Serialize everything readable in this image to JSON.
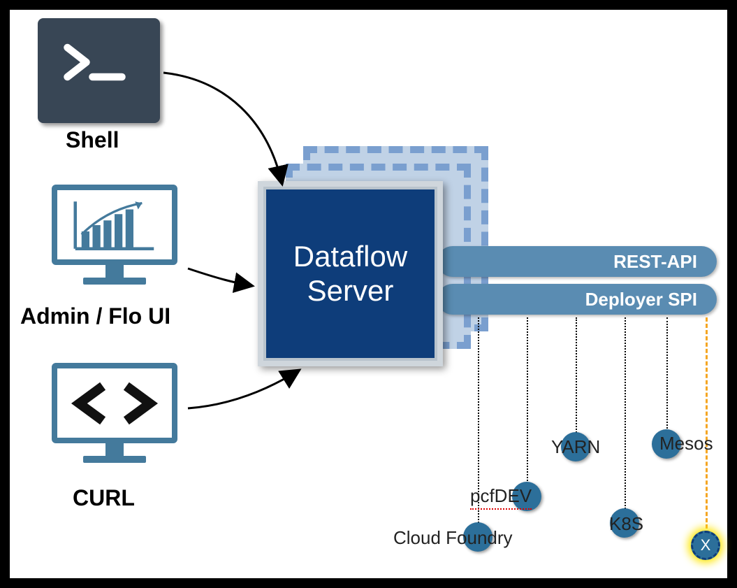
{
  "clients": {
    "shell": {
      "label": "Shell"
    },
    "admin_ui": {
      "label": "Admin / Flo UI"
    },
    "curl": {
      "label": "CURL"
    }
  },
  "server": {
    "title_line1": "Dataflow",
    "title_line2": "Server"
  },
  "apis": {
    "rest": "REST-API",
    "deployer": "Deployer SPI"
  },
  "deployers": {
    "cloud_foundry": "Cloud Foundry",
    "pcfdev": "pcfDEV",
    "yarn": "YARN",
    "k8s": "K8S",
    "mesos": "Mesos",
    "future": "X"
  }
}
